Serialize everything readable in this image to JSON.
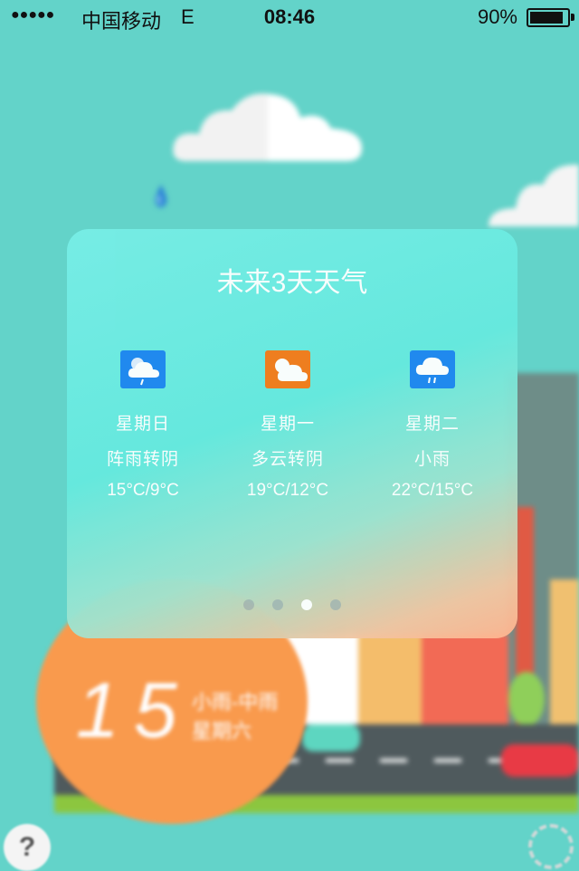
{
  "status_bar": {
    "signal": "●●●●●",
    "carrier": "中国移动",
    "network": "E",
    "time": "08:46",
    "battery_percent": "90%",
    "battery_level": 0.9
  },
  "card": {
    "title": "未来3天天气",
    "days": [
      {
        "name": "星期日",
        "condition": "阵雨转阴",
        "temp": "15°C/9°C",
        "icon": "shower-cloud-icon",
        "icon_color": "#1e86f0"
      },
      {
        "name": "星期一",
        "condition": "多云转阴",
        "temp": "19°C/12°C",
        "icon": "sun-cloud-icon",
        "icon_color": "#f47b19"
      },
      {
        "name": "星期二",
        "condition": "小雨",
        "temp": "22°C/15°C",
        "icon": "rain-cloud-icon",
        "icon_color": "#1e86f0"
      }
    ],
    "pages": 4,
    "active_page": 3
  },
  "background": {
    "temperature": "15",
    "condition": "小雨-中雨",
    "weekday": "星期六",
    "circle_color": "#f99a4d"
  },
  "buttons": {
    "help_label": "?"
  }
}
